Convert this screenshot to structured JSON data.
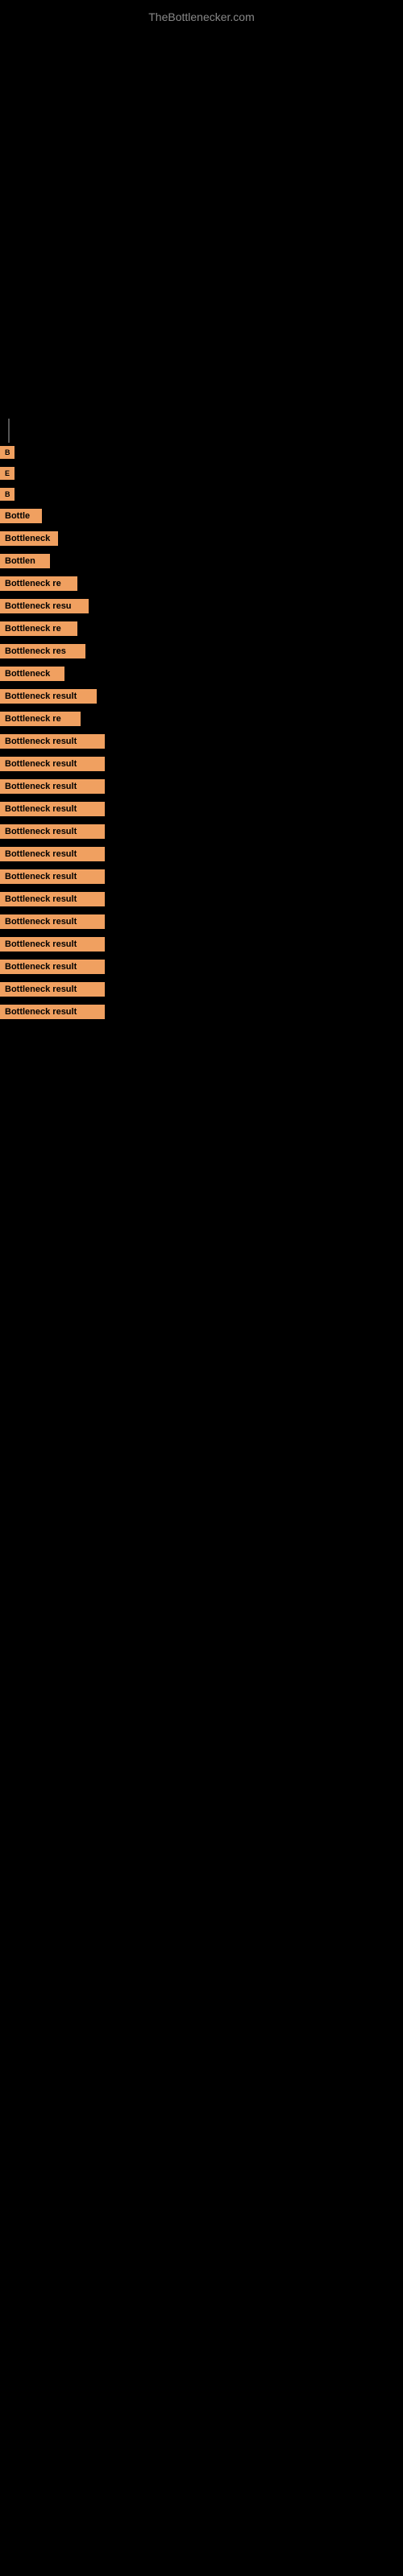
{
  "site": {
    "title": "TheBottlenecker.com"
  },
  "items": [
    {
      "id": 1,
      "label": "B",
      "size_class": "item-1"
    },
    {
      "id": 2,
      "label": "E",
      "size_class": "item-2"
    },
    {
      "id": 3,
      "label": "B",
      "size_class": "item-3"
    },
    {
      "id": 4,
      "label": "Bottle",
      "size_class": "item-4"
    },
    {
      "id": 5,
      "label": "Bottleneck",
      "size_class": "item-5"
    },
    {
      "id": 6,
      "label": "Bottlen",
      "size_class": "item-6"
    },
    {
      "id": 7,
      "label": "Bottleneck re",
      "size_class": "item-7"
    },
    {
      "id": 8,
      "label": "Bottleneck resu",
      "size_class": "item-8"
    },
    {
      "id": 9,
      "label": "Bottleneck re",
      "size_class": "item-9"
    },
    {
      "id": 10,
      "label": "Bottleneck res",
      "size_class": "item-10"
    },
    {
      "id": 11,
      "label": "Bottleneck",
      "size_class": "item-11"
    },
    {
      "id": 12,
      "label": "Bottleneck result",
      "size_class": "item-12"
    },
    {
      "id": 13,
      "label": "Bottleneck re",
      "size_class": "item-13"
    },
    {
      "id": 14,
      "label": "Bottleneck result",
      "size_class": "item-14"
    },
    {
      "id": 15,
      "label": "Bottleneck result",
      "size_class": "item-15"
    },
    {
      "id": 16,
      "label": "Bottleneck result",
      "size_class": "item-16"
    },
    {
      "id": 17,
      "label": "Bottleneck result",
      "size_class": "item-17"
    },
    {
      "id": 18,
      "label": "Bottleneck result",
      "size_class": "item-18"
    },
    {
      "id": 19,
      "label": "Bottleneck result",
      "size_class": "item-19"
    },
    {
      "id": 20,
      "label": "Bottleneck result",
      "size_class": "item-20"
    },
    {
      "id": 21,
      "label": "Bottleneck result",
      "size_class": "item-21"
    },
    {
      "id": 22,
      "label": "Bottleneck result",
      "size_class": "item-22"
    },
    {
      "id": 23,
      "label": "Bottleneck result",
      "size_class": "item-23"
    },
    {
      "id": 24,
      "label": "Bottleneck result",
      "size_class": "item-24"
    },
    {
      "id": 25,
      "label": "Bottleneck result",
      "size_class": "item-25"
    },
    {
      "id": 26,
      "label": "Bottleneck result",
      "size_class": "item-26"
    }
  ]
}
